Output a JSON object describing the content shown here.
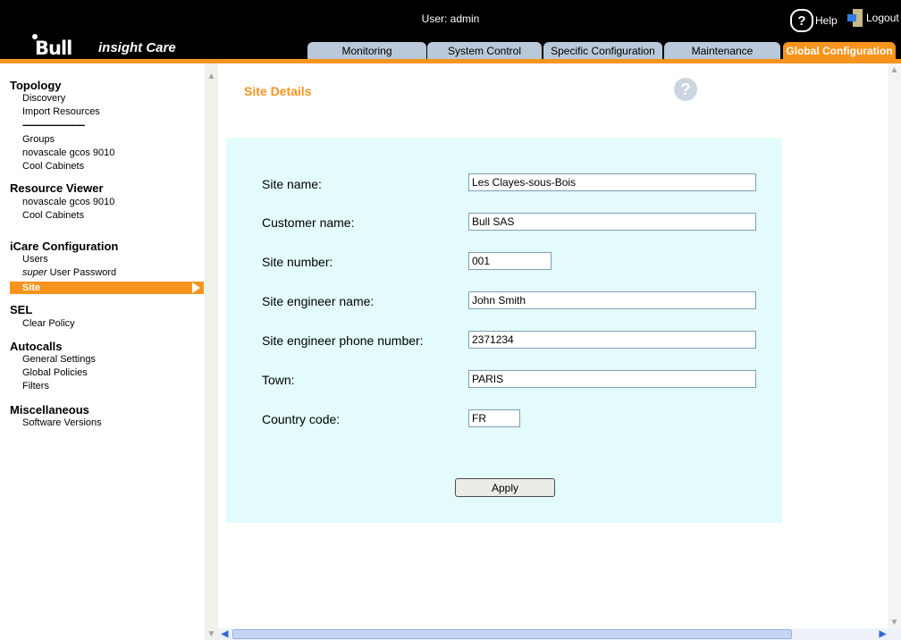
{
  "header": {
    "logo_text": "Bull",
    "product_name": "insight Care",
    "user_label": "User: admin",
    "help_label": "Help",
    "logout_label": "Logout"
  },
  "tabs": [
    {
      "label": "Monitoring",
      "active": false
    },
    {
      "label": "System Control",
      "active": false
    },
    {
      "label": "Specific Configuration",
      "active": false
    },
    {
      "label": "Maintenance",
      "active": false
    },
    {
      "label": "Global Configuration",
      "active": true
    }
  ],
  "nav": {
    "topology": {
      "title": "Topology",
      "items": [
        "Discovery",
        "Import Resources"
      ],
      "separator": "--------------------------",
      "items2": [
        "Groups",
        "novascale gcos 9010",
        "Cool Cabinets"
      ]
    },
    "resource_viewer": {
      "title": "Resource Viewer",
      "items": [
        "novascale gcos 9010",
        "Cool Cabinets"
      ]
    },
    "icare_configuration": {
      "title": "iCare Configuration",
      "items": [
        "Users",
        "User Password",
        "Site"
      ],
      "super_prefix": "super"
    },
    "sel": {
      "title": "SEL",
      "items": [
        "Clear Policy"
      ]
    },
    "autocalls": {
      "title": "Autocalls",
      "items": [
        "General Settings",
        "Global Policies",
        "Filters"
      ]
    },
    "miscellaneous": {
      "title": "Miscellaneous",
      "items": [
        "Software Versions"
      ]
    }
  },
  "main": {
    "title": "Site Details",
    "fields": {
      "site_name": {
        "label": "Site name:",
        "value": "Les Clayes-sous-Bois"
      },
      "customer_name": {
        "label": "Customer name:",
        "value": "Bull SAS"
      },
      "site_number": {
        "label": "Site number:",
        "value": "001"
      },
      "site_engineer_name": {
        "label": "Site engineer name:",
        "value": "John Smith"
      },
      "site_engineer_phone": {
        "label": "Site engineer phone number:",
        "value": "2371234"
      },
      "town": {
        "label": "Town:",
        "value": "PARIS"
      },
      "country_code": {
        "label": "Country code:",
        "value": "FR"
      }
    },
    "apply_label": "Apply"
  },
  "colors": {
    "accent": "#f7941d",
    "tab": "#b9c9d9",
    "panel": "#e3fbfb",
    "header": "#000000"
  }
}
